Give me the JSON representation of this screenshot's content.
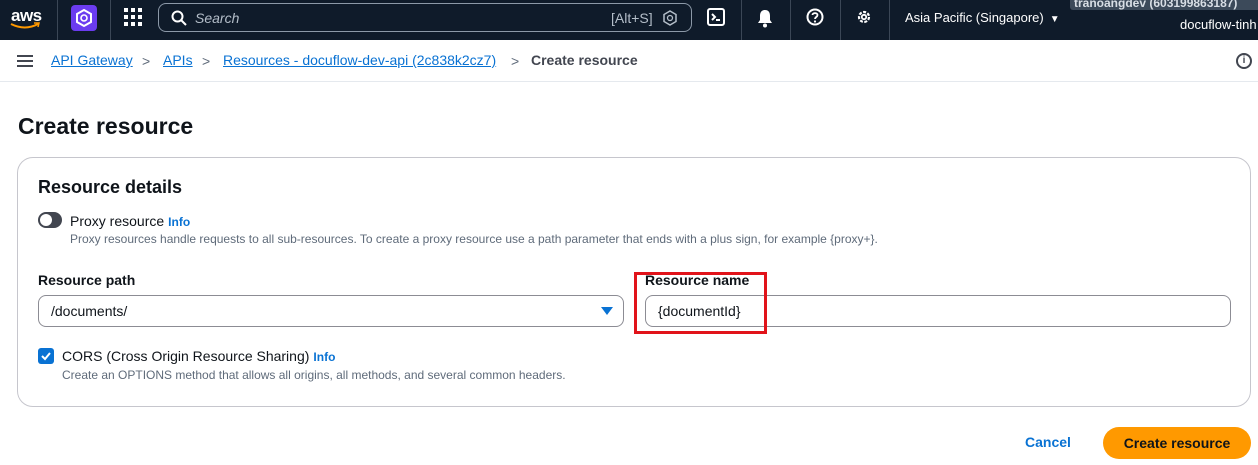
{
  "topnav": {
    "logo_text": "aws",
    "search_placeholder": "Search",
    "search_shortcut": "[Alt+S]",
    "region": "Asia Pacific (Singapore)",
    "account": "tranoangdev (603199863187)",
    "user": "docuflow-tinh",
    "colors": {
      "bg": "#0f1b2a",
      "service": "#6b3cf0"
    }
  },
  "breadcrumb": {
    "items": [
      "API Gateway",
      "APIs",
      "Resources - docuflow-dev-api (2c838k2cz7)"
    ],
    "current": "Create resource"
  },
  "page": {
    "title": "Create resource"
  },
  "details": {
    "title": "Resource details",
    "proxy": {
      "label": "Proxy resource",
      "info": "Info",
      "description": "Proxy resources handle requests to all sub-resources. To create a proxy resource use a path parameter that ends with a plus sign, for example {proxy+}.",
      "enabled": false
    },
    "path": {
      "label": "Resource path",
      "value": "/documents/"
    },
    "name": {
      "label": "Resource name",
      "value": "{documentId}"
    },
    "cors": {
      "label": "CORS (Cross Origin Resource Sharing)",
      "info": "Info",
      "description": "Create an OPTIONS method that allows all origins, all methods, and several common headers.",
      "checked": true
    }
  },
  "actions": {
    "cancel": "Cancel",
    "submit": "Create resource"
  },
  "colors": {
    "link": "#0972d3",
    "primary": "#ff9900",
    "highlight": "#e1131a"
  }
}
